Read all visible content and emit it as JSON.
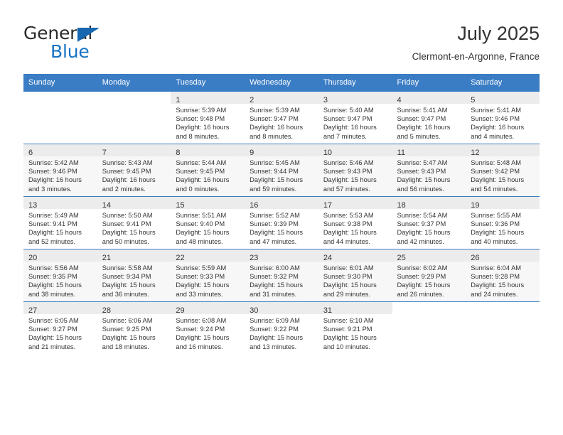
{
  "brand": {
    "line1": "General",
    "line2": "Blue",
    "triangle_color": "#1666b0",
    "text_color": "#2b2b2b",
    "blue_color": "#1573c4"
  },
  "header": {
    "title": "July 2025",
    "subtitle": "Clermont-en-Argonne, France"
  },
  "theme": {
    "header_bg": "#3b7dc4",
    "header_text": "#ffffff",
    "daynum_bg": "#ececec",
    "alt_row_bg": "#f7f7f7",
    "grid_line": "#3b7dc4",
    "body_text": "#333333"
  },
  "weekdays": [
    "Sunday",
    "Monday",
    "Tuesday",
    "Wednesday",
    "Thursday",
    "Friday",
    "Saturday"
  ],
  "weeks": [
    [
      {
        "day": "",
        "lines": []
      },
      {
        "day": "",
        "lines": []
      },
      {
        "day": "1",
        "lines": [
          "Sunrise: 5:39 AM",
          "Sunset: 9:48 PM",
          "Daylight: 16 hours",
          "and 8 minutes."
        ]
      },
      {
        "day": "2",
        "lines": [
          "Sunrise: 5:39 AM",
          "Sunset: 9:47 PM",
          "Daylight: 16 hours",
          "and 8 minutes."
        ]
      },
      {
        "day": "3",
        "lines": [
          "Sunrise: 5:40 AM",
          "Sunset: 9:47 PM",
          "Daylight: 16 hours",
          "and 7 minutes."
        ]
      },
      {
        "day": "4",
        "lines": [
          "Sunrise: 5:41 AM",
          "Sunset: 9:47 PM",
          "Daylight: 16 hours",
          "and 5 minutes."
        ]
      },
      {
        "day": "5",
        "lines": [
          "Sunrise: 5:41 AM",
          "Sunset: 9:46 PM",
          "Daylight: 16 hours",
          "and 4 minutes."
        ]
      }
    ],
    [
      {
        "day": "6",
        "lines": [
          "Sunrise: 5:42 AM",
          "Sunset: 9:46 PM",
          "Daylight: 16 hours",
          "and 3 minutes."
        ]
      },
      {
        "day": "7",
        "lines": [
          "Sunrise: 5:43 AM",
          "Sunset: 9:45 PM",
          "Daylight: 16 hours",
          "and 2 minutes."
        ]
      },
      {
        "day": "8",
        "lines": [
          "Sunrise: 5:44 AM",
          "Sunset: 9:45 PM",
          "Daylight: 16 hours",
          "and 0 minutes."
        ]
      },
      {
        "day": "9",
        "lines": [
          "Sunrise: 5:45 AM",
          "Sunset: 9:44 PM",
          "Daylight: 15 hours",
          "and 59 minutes."
        ]
      },
      {
        "day": "10",
        "lines": [
          "Sunrise: 5:46 AM",
          "Sunset: 9:43 PM",
          "Daylight: 15 hours",
          "and 57 minutes."
        ]
      },
      {
        "day": "11",
        "lines": [
          "Sunrise: 5:47 AM",
          "Sunset: 9:43 PM",
          "Daylight: 15 hours",
          "and 56 minutes."
        ]
      },
      {
        "day": "12",
        "lines": [
          "Sunrise: 5:48 AM",
          "Sunset: 9:42 PM",
          "Daylight: 15 hours",
          "and 54 minutes."
        ]
      }
    ],
    [
      {
        "day": "13",
        "lines": [
          "Sunrise: 5:49 AM",
          "Sunset: 9:41 PM",
          "Daylight: 15 hours",
          "and 52 minutes."
        ]
      },
      {
        "day": "14",
        "lines": [
          "Sunrise: 5:50 AM",
          "Sunset: 9:41 PM",
          "Daylight: 15 hours",
          "and 50 minutes."
        ]
      },
      {
        "day": "15",
        "lines": [
          "Sunrise: 5:51 AM",
          "Sunset: 9:40 PM",
          "Daylight: 15 hours",
          "and 48 minutes."
        ]
      },
      {
        "day": "16",
        "lines": [
          "Sunrise: 5:52 AM",
          "Sunset: 9:39 PM",
          "Daylight: 15 hours",
          "and 47 minutes."
        ]
      },
      {
        "day": "17",
        "lines": [
          "Sunrise: 5:53 AM",
          "Sunset: 9:38 PM",
          "Daylight: 15 hours",
          "and 44 minutes."
        ]
      },
      {
        "day": "18",
        "lines": [
          "Sunrise: 5:54 AM",
          "Sunset: 9:37 PM",
          "Daylight: 15 hours",
          "and 42 minutes."
        ]
      },
      {
        "day": "19",
        "lines": [
          "Sunrise: 5:55 AM",
          "Sunset: 9:36 PM",
          "Daylight: 15 hours",
          "and 40 minutes."
        ]
      }
    ],
    [
      {
        "day": "20",
        "lines": [
          "Sunrise: 5:56 AM",
          "Sunset: 9:35 PM",
          "Daylight: 15 hours",
          "and 38 minutes."
        ]
      },
      {
        "day": "21",
        "lines": [
          "Sunrise: 5:58 AM",
          "Sunset: 9:34 PM",
          "Daylight: 15 hours",
          "and 36 minutes."
        ]
      },
      {
        "day": "22",
        "lines": [
          "Sunrise: 5:59 AM",
          "Sunset: 9:33 PM",
          "Daylight: 15 hours",
          "and 33 minutes."
        ]
      },
      {
        "day": "23",
        "lines": [
          "Sunrise: 6:00 AM",
          "Sunset: 9:32 PM",
          "Daylight: 15 hours",
          "and 31 minutes."
        ]
      },
      {
        "day": "24",
        "lines": [
          "Sunrise: 6:01 AM",
          "Sunset: 9:30 PM",
          "Daylight: 15 hours",
          "and 29 minutes."
        ]
      },
      {
        "day": "25",
        "lines": [
          "Sunrise: 6:02 AM",
          "Sunset: 9:29 PM",
          "Daylight: 15 hours",
          "and 26 minutes."
        ]
      },
      {
        "day": "26",
        "lines": [
          "Sunrise: 6:04 AM",
          "Sunset: 9:28 PM",
          "Daylight: 15 hours",
          "and 24 minutes."
        ]
      }
    ],
    [
      {
        "day": "27",
        "lines": [
          "Sunrise: 6:05 AM",
          "Sunset: 9:27 PM",
          "Daylight: 15 hours",
          "and 21 minutes."
        ]
      },
      {
        "day": "28",
        "lines": [
          "Sunrise: 6:06 AM",
          "Sunset: 9:25 PM",
          "Daylight: 15 hours",
          "and 18 minutes."
        ]
      },
      {
        "day": "29",
        "lines": [
          "Sunrise: 6:08 AM",
          "Sunset: 9:24 PM",
          "Daylight: 15 hours",
          "and 16 minutes."
        ]
      },
      {
        "day": "30",
        "lines": [
          "Sunrise: 6:09 AM",
          "Sunset: 9:22 PM",
          "Daylight: 15 hours",
          "and 13 minutes."
        ]
      },
      {
        "day": "31",
        "lines": [
          "Sunrise: 6:10 AM",
          "Sunset: 9:21 PM",
          "Daylight: 15 hours",
          "and 10 minutes."
        ]
      },
      {
        "day": "",
        "lines": []
      },
      {
        "day": "",
        "lines": []
      }
    ]
  ]
}
